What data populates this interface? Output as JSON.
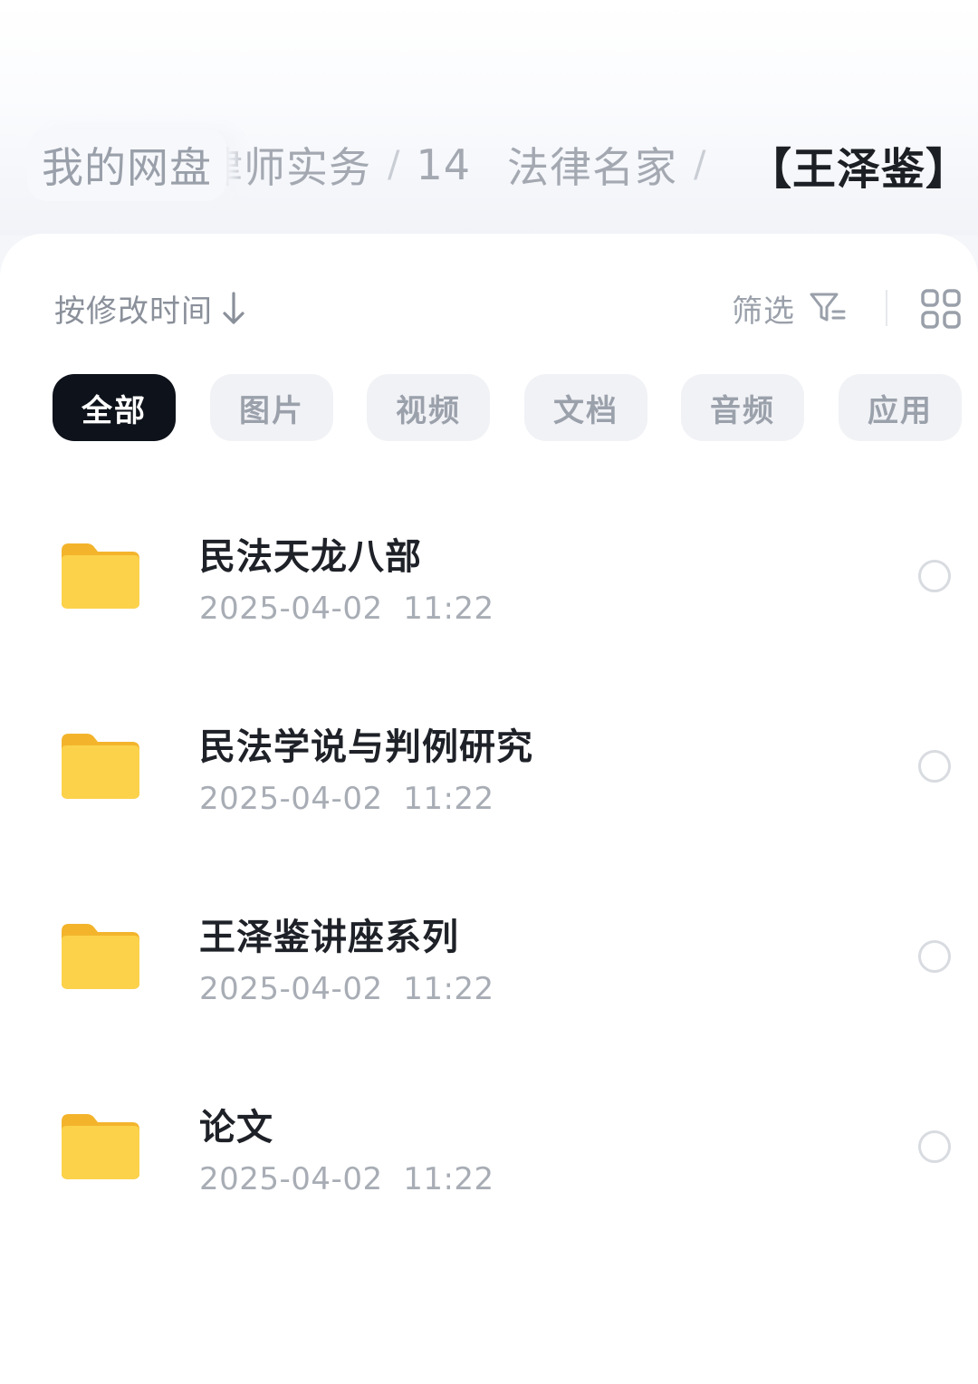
{
  "breadcrumb": {
    "root": "我的网盘",
    "segments": [
      "律师实务",
      "14",
      "法律名家"
    ],
    "current": "【王泽鉴】"
  },
  "toolbar": {
    "sort_label": "按修改时间",
    "filter_label": "筛选"
  },
  "chips": [
    {
      "label": "全部",
      "active": true
    },
    {
      "label": "图片",
      "active": false
    },
    {
      "label": "视频",
      "active": false
    },
    {
      "label": "文档",
      "active": false
    },
    {
      "label": "音频",
      "active": false
    },
    {
      "label": "应用",
      "active": false
    }
  ],
  "files": [
    {
      "name": "民法天龙八部",
      "modified": "2025-04-02  11:22",
      "icon": "folder-icon"
    },
    {
      "name": "民法学说与判例研究",
      "modified": "2025-04-02  11:22",
      "icon": "folder-icon"
    },
    {
      "name": "王泽鉴讲座系列",
      "modified": "2025-04-02  11:22",
      "icon": "folder-icon"
    },
    {
      "name": "论文",
      "modified": "2025-04-02  11:22",
      "icon": "folder-icon"
    }
  ],
  "colors": {
    "accent_dark": "#0e121a",
    "folder_yellow": "#f9c93c"
  }
}
